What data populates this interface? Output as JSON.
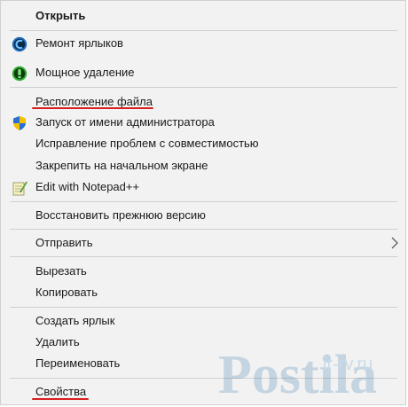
{
  "menu": {
    "items": [
      {
        "label": "Открыть"
      },
      {
        "label": "Ремонт ярлыков",
        "icon": "repair-shortcut-icon"
      },
      {
        "label": "Мощное удаление",
        "icon": "uninstall-icon"
      },
      {
        "label": "Расположение файла"
      },
      {
        "label": "Запуск от имени администратора",
        "icon": "uac-shield-icon"
      },
      {
        "label": "Исправление проблем с совместимостью"
      },
      {
        "label": "Закрепить на начальном экране"
      },
      {
        "label": "Edit with Notepad++",
        "icon": "notepad-plus-plus-icon"
      },
      {
        "label": "Восстановить прежнюю версию"
      },
      {
        "label": "Отправить",
        "icon": "chevron-right-icon"
      },
      {
        "label": "Вырезать"
      },
      {
        "label": "Копировать"
      },
      {
        "label": "Создать ярлык"
      },
      {
        "label": "Удалить"
      },
      {
        "label": "Переименовать"
      },
      {
        "label": "Свойства"
      }
    ]
  },
  "colors": {
    "menu_bg": "#f2f2f2",
    "highlight_underline": "#d81e1e"
  },
  "watermark": {
    "text": "Postila",
    "site": "ir-rv.ru"
  }
}
